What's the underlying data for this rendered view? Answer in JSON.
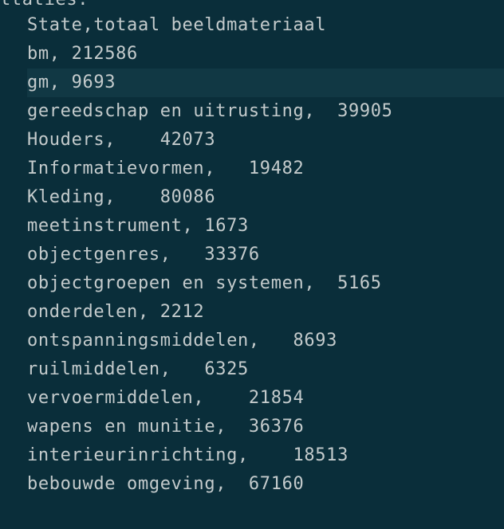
{
  "editor": {
    "partial_top": "ttaties:",
    "current_line_index": 2,
    "lines": [
      "State,totaal beeldmateriaal",
      "bm, 212586",
      "gm, 9693",
      "gereedschap en uitrusting,  39905",
      "Houders,    42073",
      "Informatievormen,   19482",
      "Kleding,    80086",
      "meetinstrument, 1673",
      "objectgenres,   33376",
      "objectgroepen en systemen,  5165",
      "onderdelen, 2212",
      "ontspanningsmiddelen,   8693",
      "ruilmiddelen,   6325",
      "vervoermiddelen,    21854",
      "wapens en munitie,  36376",
      "interieurinrichting,    18513",
      "bebouwde omgeving,  67160"
    ]
  },
  "colors": {
    "background": "#0a2e3a",
    "current_line": "#113844",
    "text": "#c4cbcc"
  }
}
